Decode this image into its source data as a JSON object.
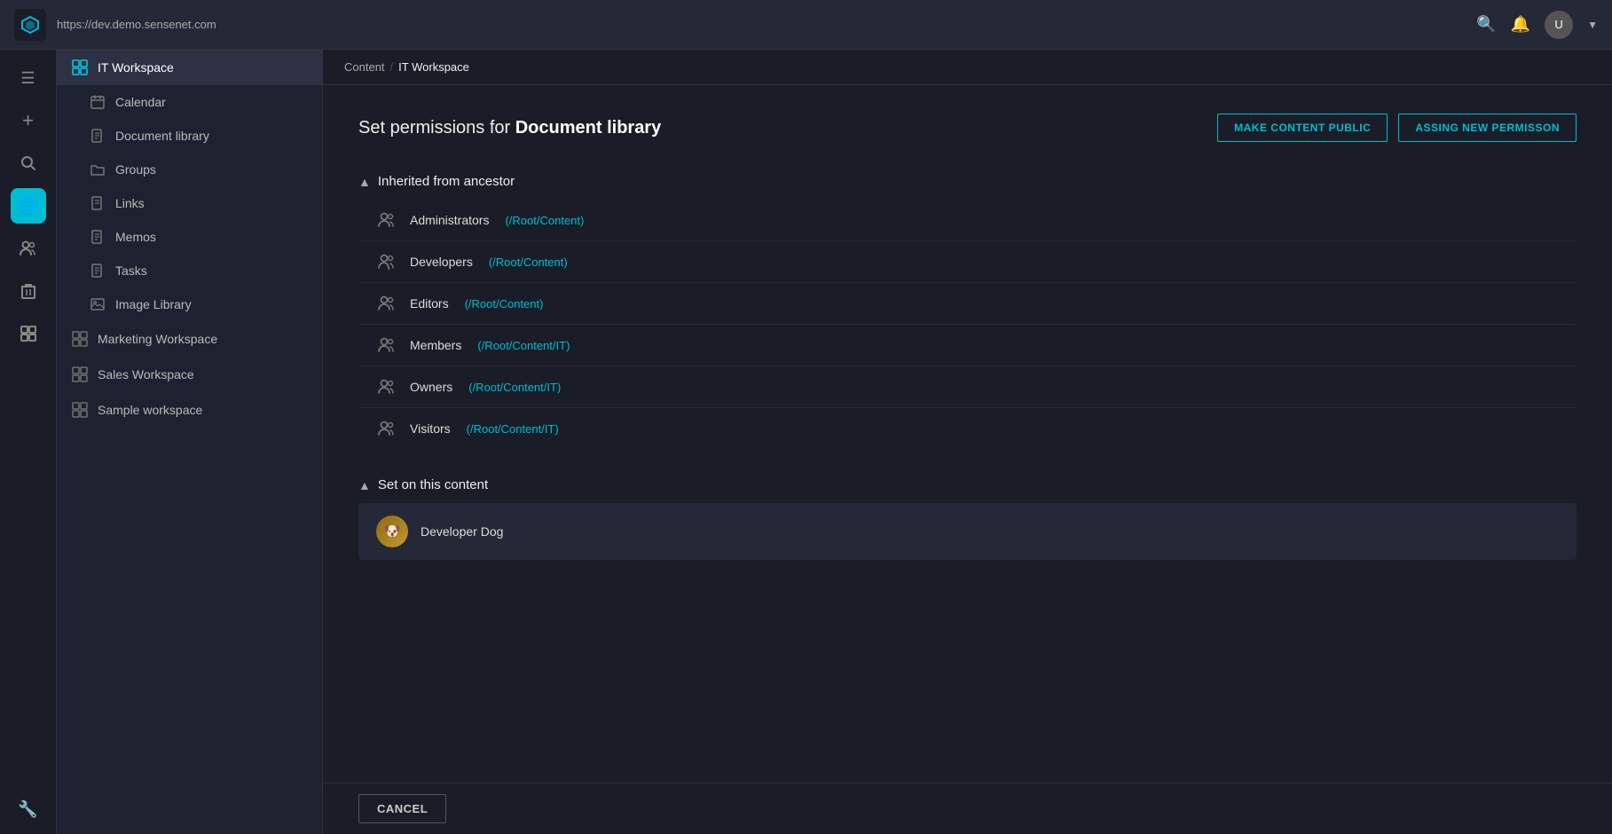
{
  "topbar": {
    "url": "https://dev.demo.sensenet.com",
    "logo_icon": "⬡"
  },
  "breadcrumb": {
    "items": [
      {
        "label": "Content",
        "link": true
      },
      {
        "label": "IT Workspace",
        "link": false
      }
    ]
  },
  "sidebar": {
    "active_item": "IT Workspace",
    "top_item": {
      "label": "IT Workspace",
      "icon": "⊞"
    },
    "children": [
      {
        "label": "Calendar",
        "icon": "📅"
      },
      {
        "label": "Document library",
        "icon": "📄"
      },
      {
        "label": "Groups",
        "icon": "📁"
      },
      {
        "label": "Links",
        "icon": "📄"
      },
      {
        "label": "Memos",
        "icon": "📄"
      },
      {
        "label": "Tasks",
        "icon": "📄"
      },
      {
        "label": "Image Library",
        "icon": "🖼"
      }
    ],
    "workspace_items": [
      {
        "label": "Marketing Workspace",
        "icon": "⊞"
      },
      {
        "label": "Sales Workspace",
        "icon": "⊞"
      },
      {
        "label": "Sample workspace",
        "icon": "⊞"
      }
    ]
  },
  "permissions": {
    "title_prefix": "Set permissions for ",
    "title_target": "Document library",
    "btn_public": "MAKE CONTENT PUBLIC",
    "btn_assign": "ASSING NEW PERMISSON",
    "inherited_section": {
      "label": "Inherited from ancestor",
      "rows": [
        {
          "name": "Administrators",
          "path": "(/Root/Content)"
        },
        {
          "name": "Developers",
          "path": "(/Root/Content)"
        },
        {
          "name": "Editors",
          "path": "(/Root/Content)"
        },
        {
          "name": "Members",
          "path": "(/Root/Content/IT)"
        },
        {
          "name": "Owners",
          "path": "(/Root/Content/IT)"
        },
        {
          "name": "Visitors",
          "path": "(/Root/Content/IT)"
        }
      ]
    },
    "set_on_content_section": {
      "label": "Set on this content",
      "rows": [
        {
          "name": "Developer Dog",
          "avatar_text": "🐶"
        }
      ]
    }
  },
  "footer": {
    "cancel_label": "CANCEL"
  },
  "iconbar": {
    "icons": [
      {
        "name": "hamburger-menu-icon",
        "symbol": "☰"
      },
      {
        "name": "plus-icon",
        "symbol": "+"
      },
      {
        "name": "search-icon",
        "symbol": "🔍"
      },
      {
        "name": "globe-icon",
        "symbol": "🌐",
        "active": true
      },
      {
        "name": "people-icon",
        "symbol": "👥"
      },
      {
        "name": "trash-icon",
        "symbol": "🗑"
      },
      {
        "name": "widgets-icon",
        "symbol": "⊞"
      },
      {
        "name": "wrench-icon",
        "symbol": "🔧"
      }
    ]
  }
}
